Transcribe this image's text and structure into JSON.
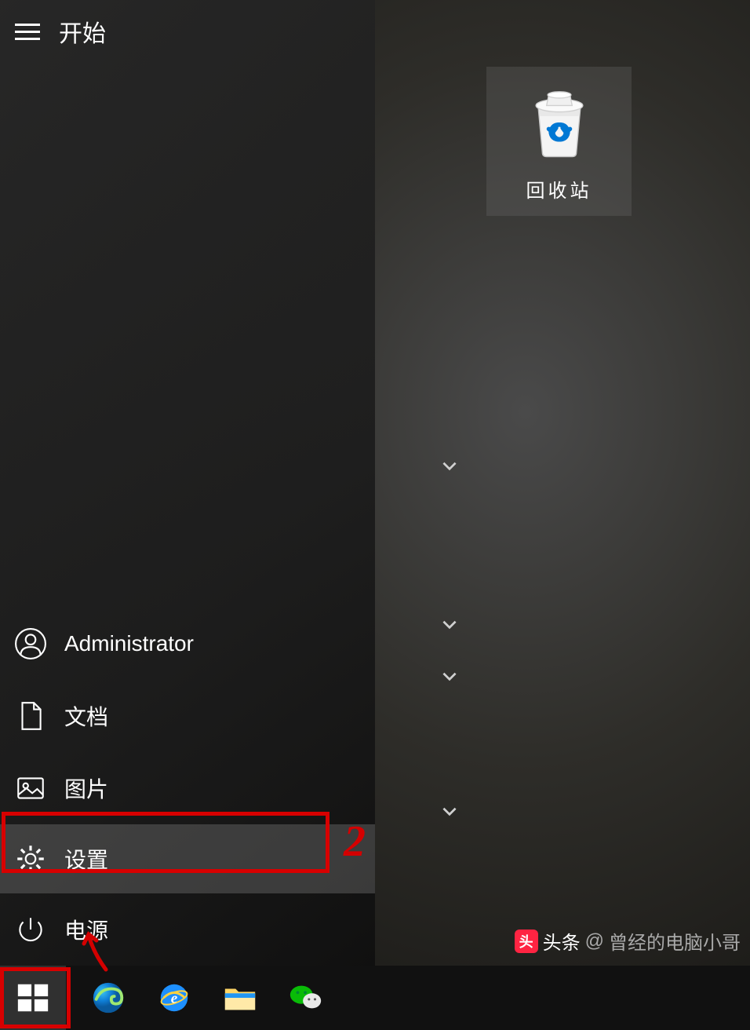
{
  "start_menu": {
    "title": "开始",
    "items": {
      "user": "Administrator",
      "documents": "文档",
      "pictures": "图片",
      "settings": "设置",
      "power": "电源"
    }
  },
  "desktop": {
    "recycle_bin": "回收站"
  },
  "annotations": {
    "step2": "2"
  },
  "watermark": {
    "prefix": "头条",
    "at": "@",
    "author": "曾经的电脑小哥"
  }
}
